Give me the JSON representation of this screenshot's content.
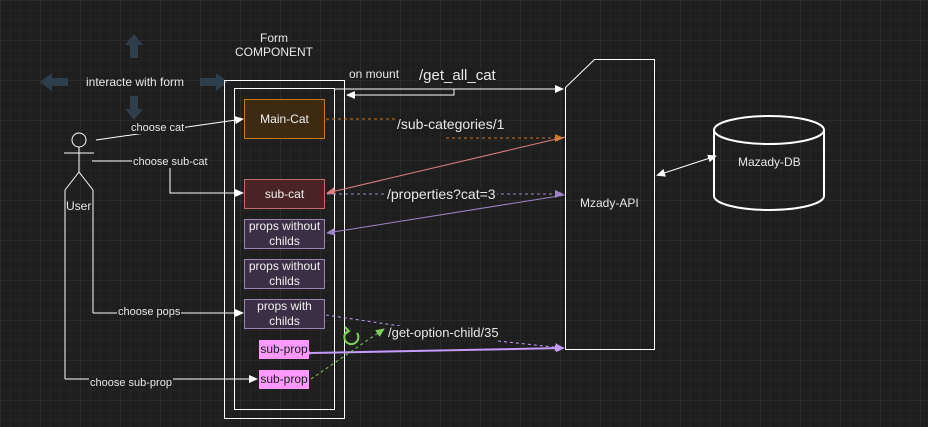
{
  "nav_arrow_label": "interacte with form",
  "form_title_line1": "Form",
  "form_title_line2": "COMPONENT",
  "on_mount": "on mount",
  "endpoints": {
    "all_cat": "/get_all_cat",
    "sub_categories": "/sub-categories/1",
    "properties": "/properties?cat=3",
    "option_child": "/get-option-child/35"
  },
  "user_label": "User",
  "actions": {
    "choose_cat": "choose cat",
    "choose_sub_cat": "choose sub-cat",
    "choose_pops": "choose pops",
    "choose_sub_prop": "choose sub-prop"
  },
  "boxes": {
    "main_cat": "Main-Cat",
    "sub_cat": "sub-cat",
    "props_without_childs_1": "props without childs",
    "props_without_childs_2": "props without childs",
    "props_with_childs": "props with childs",
    "sub_prop_1": "sub-prop",
    "sub_prop_2": "sub-prop"
  },
  "api_label": "Mzady-API",
  "db_label": "Mazady-DB",
  "colors": {
    "main_cat_fill": "#3d2a12",
    "main_cat_stroke": "#c9791c",
    "sub_cat_fill": "#4a2424",
    "sub_cat_stroke": "#c46a6a",
    "props_fill": "#3a2f45",
    "props_stroke": "#9a86b0",
    "sub_prop_fill": "#ff99ff",
    "orange_arrow": "#c9791c",
    "pink_arrow": "#e08080",
    "purple_arrow": "#9f84c8",
    "violet_arrow": "#c59bff",
    "green_arrow": "#7fd05a"
  }
}
